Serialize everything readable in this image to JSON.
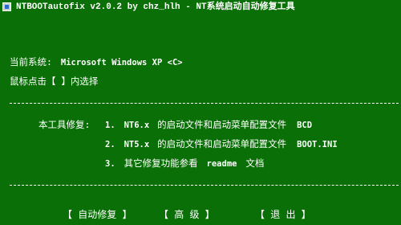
{
  "window": {
    "title": "NTBOOTautofix v2.0.2 by chz_hlh - NT系统启动自动修复工具"
  },
  "info": {
    "current_system_label": "当前系统:",
    "current_system_value": "Microsoft Windows XP  <C>",
    "hint": "鼠标点击【 】内选择"
  },
  "description": {
    "intro": "本工具修复:",
    "item1_num": "1.",
    "item1_prefix": "NT6.x",
    "item1_text": "的启动文件和启动菜单配置文件",
    "item1_suffix": "BCD",
    "item2_num": "2.",
    "item2_prefix": "NT5.x",
    "item2_text": "的启动文件和启动菜单配置文件",
    "item2_suffix": "BOOT.INI",
    "item3_num": "3.",
    "item3_text": "其它修复功能参看",
    "item3_mid": "readme",
    "item3_end": "文档"
  },
  "buttons": {
    "auto_repair": "【 自动修复 】",
    "advanced": "【 高  级 】",
    "exit": "【 退  出 】"
  },
  "colors": {
    "background": "#0a6f07",
    "text": "#ffffff"
  }
}
